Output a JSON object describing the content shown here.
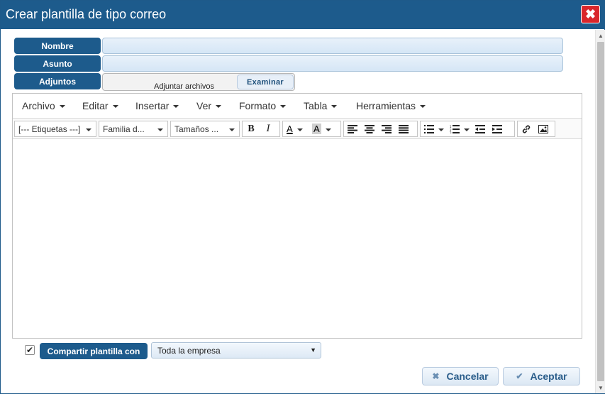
{
  "dialog": {
    "title": "Crear plantilla de tipo correo",
    "close_label": "✖"
  },
  "form": {
    "name_label": "Nombre",
    "name_value": "",
    "subject_label": "Asunto",
    "subject_value": "",
    "attachments_label": "Adjuntos",
    "attach_text": "Adjuntar archivos",
    "browse_label": "Examinar"
  },
  "editor": {
    "menu": [
      "Archivo",
      "Editar",
      "Insertar",
      "Ver",
      "Formato",
      "Tabla",
      "Herramientas"
    ],
    "tags_select": "[--- Etiquetas ---]",
    "font_family_select": "Familia d...",
    "font_size_select": "Tamaños ...",
    "bold": "B",
    "italic": "I",
    "text_color": "A",
    "bg_color": "A",
    "content": ""
  },
  "share": {
    "checked": true,
    "check_mark": "✔",
    "label": "Compartir plantilla con",
    "selected": "Toda la empresa",
    "arrow": "▼"
  },
  "footer": {
    "cancel_label": "Cancelar",
    "cancel_icon": "✖",
    "accept_label": "Aceptar",
    "accept_icon": "✔"
  },
  "colors": {
    "accent": "#1d5b8c",
    "close": "#d9262b"
  }
}
